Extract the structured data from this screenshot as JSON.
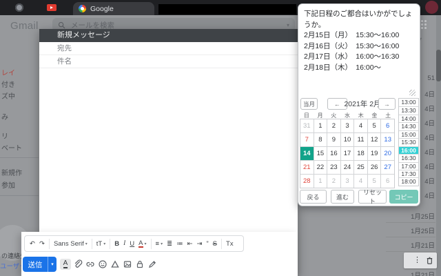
{
  "browser": {
    "active_tab": "Google"
  },
  "gmail": {
    "logo": "Gmail",
    "search_placeholder": "メールを検索",
    "sidebar_items": [
      "レイ",
      "付き",
      "ズ中",
      "み",
      "リ",
      "ベート",
      "新規作",
      "参加"
    ],
    "contacts_fragment": "の連絡先",
    "contacts_link_fragment": "ユーザーな",
    "list_fragments": [
      "51",
      "4日",
      "4日",
      "4日",
      "4日",
      "4日",
      "4日",
      "4日",
      "4日"
    ],
    "list_dates": [
      "1月25日",
      "1月25日",
      "1月21日",
      "1月21日"
    ]
  },
  "compose": {
    "title": "新規メッセージ",
    "to_label": "宛先",
    "subject_label": "件名",
    "send_label": "送信",
    "action_icons": [
      "formatting-options",
      "attach-file",
      "insert-link",
      "insert-emoji",
      "insert-drive-file",
      "insert-photo",
      "confidential-mode",
      "insert-signature"
    ],
    "format_items": [
      {
        "name": "undo",
        "glyph": "↶"
      },
      {
        "name": "redo",
        "glyph": "↷"
      },
      {
        "name": "sep"
      },
      {
        "name": "font-family",
        "glyph": "Sans Serif",
        "caret": true
      },
      {
        "name": "sep"
      },
      {
        "name": "font-size",
        "glyph": "tT",
        "caret": true
      },
      {
        "name": "sep"
      },
      {
        "name": "bold",
        "glyph": "B"
      },
      {
        "name": "italic",
        "glyph": "I"
      },
      {
        "name": "underline",
        "glyph": "U"
      },
      {
        "name": "text-color",
        "glyph": "A",
        "caret": true
      },
      {
        "name": "sep"
      },
      {
        "name": "align",
        "glyph": "≡",
        "caret": true
      },
      {
        "name": "numbered-list",
        "glyph": "≣"
      },
      {
        "name": "bulleted-list",
        "glyph": "≔"
      },
      {
        "name": "indent-less",
        "glyph": "⇤"
      },
      {
        "name": "indent-more",
        "glyph": "⇥"
      },
      {
        "name": "quote",
        "glyph": "”"
      },
      {
        "name": "strikethrough",
        "glyph": "S"
      },
      {
        "name": "sep"
      },
      {
        "name": "clear-format",
        "glyph": "Tx"
      }
    ]
  },
  "popup": {
    "message": "下記日程のご都合はいかがでしょうか。\n2月15日（月）　15:30～16:00\n2月16日（火）　15:30～16:00\n2月17日（水）　16:00～16:30\n2月18日（木）　16:00～",
    "calendar": {
      "nav_current": "当月",
      "nav_prev": "←",
      "nav_next": "→",
      "title": "2021年 2月",
      "day_headers": [
        "日",
        "月",
        "火",
        "水",
        "木",
        "金",
        "土"
      ],
      "selected_date": "14",
      "weeks": [
        [
          {
            "d": "31",
            "t": "muted"
          },
          {
            "d": "1",
            "t": "n"
          },
          {
            "d": "2",
            "t": "n"
          },
          {
            "d": "3",
            "t": "n"
          },
          {
            "d": "4",
            "t": "n"
          },
          {
            "d": "5",
            "t": "n"
          },
          {
            "d": "6",
            "t": "sat"
          }
        ],
        [
          {
            "d": "7",
            "t": "sun"
          },
          {
            "d": "8",
            "t": "n"
          },
          {
            "d": "9",
            "t": "n"
          },
          {
            "d": "10",
            "t": "n"
          },
          {
            "d": "11",
            "t": "n"
          },
          {
            "d": "12",
            "t": "n"
          },
          {
            "d": "13",
            "t": "sat"
          }
        ],
        [
          {
            "d": "14",
            "t": "sel"
          },
          {
            "d": "15",
            "t": "n"
          },
          {
            "d": "16",
            "t": "n"
          },
          {
            "d": "17",
            "t": "n"
          },
          {
            "d": "18",
            "t": "n"
          },
          {
            "d": "19",
            "t": "n"
          },
          {
            "d": "20",
            "t": "sat"
          }
        ],
        [
          {
            "d": "21",
            "t": "sun"
          },
          {
            "d": "22",
            "t": "n"
          },
          {
            "d": "23",
            "t": "n"
          },
          {
            "d": "24",
            "t": "n"
          },
          {
            "d": "25",
            "t": "n"
          },
          {
            "d": "26",
            "t": "n"
          },
          {
            "d": "27",
            "t": "sat"
          }
        ],
        [
          {
            "d": "28",
            "t": "sun"
          },
          {
            "d": "1",
            "t": "muted"
          },
          {
            "d": "2",
            "t": "muted"
          },
          {
            "d": "3",
            "t": "muted"
          },
          {
            "d": "4",
            "t": "muted"
          },
          {
            "d": "5",
            "t": "muted"
          },
          {
            "d": "6",
            "t": "muted"
          }
        ]
      ]
    },
    "times": {
      "slots": [
        "13:00",
        "13:30",
        "14:00",
        "14:30",
        "15:00",
        "15:30",
        "16:00",
        "16:30",
        "17:00",
        "17:30",
        "18:00"
      ],
      "selected": "16:00"
    },
    "buttons": {
      "back": "戻る",
      "forward": "進む",
      "reset": "リセット",
      "copy": "コピー"
    }
  },
  "colors": {
    "selected_date_teal": "#12a38a",
    "selected_time_cyan": "#32d1d5",
    "copy_button_teal": "#74c8b7",
    "send_blue": "#1a73e8",
    "sunday_red": "#e0453c",
    "saturday_blue": "#2e6be4"
  }
}
